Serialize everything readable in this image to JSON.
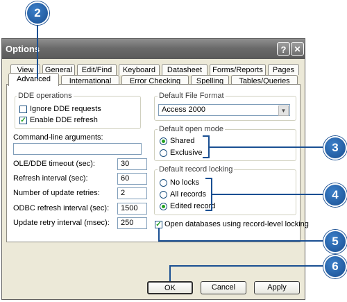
{
  "window": {
    "title": "Options",
    "help_glyph": "?",
    "close_glyph": "✕"
  },
  "tabs": {
    "row1": [
      "View",
      "General",
      "Edit/Find",
      "Keyboard",
      "Datasheet",
      "Forms/Reports",
      "Pages"
    ],
    "row2": [
      "Advanced",
      "International",
      "Error Checking",
      "Spelling",
      "Tables/Queries"
    ],
    "active": "Advanced"
  },
  "dde": {
    "group_label": "DDE operations",
    "ignore_label": "Ignore DDE requests",
    "ignore_checked": false,
    "enable_label": "Enable DDE refresh",
    "enable_checked": true
  },
  "cmdline": {
    "label": "Command-line arguments:",
    "value": ""
  },
  "settings": [
    {
      "label": "OLE/DDE timeout (sec):",
      "value": "30"
    },
    {
      "label": "Refresh interval (sec):",
      "value": "60"
    },
    {
      "label": "Number of update retries:",
      "value": "2"
    },
    {
      "label": "ODBC refresh interval (sec):",
      "value": "1500"
    },
    {
      "label": "Update retry interval (msec):",
      "value": "250"
    }
  ],
  "file_format": {
    "group_label": "Default File Format",
    "selected": "Access 2000"
  },
  "open_mode": {
    "group_label": "Default open mode",
    "options": [
      "Shared",
      "Exclusive"
    ],
    "selected": "Shared"
  },
  "record_locking": {
    "group_label": "Default record locking",
    "options": [
      "No locks",
      "All records",
      "Edited record"
    ],
    "selected": "Edited record"
  },
  "record_level": {
    "label": "Open databases using record-level locking",
    "checked": true
  },
  "buttons": {
    "ok": "OK",
    "cancel": "Cancel",
    "apply": "Apply"
  },
  "callouts": [
    "2",
    "3",
    "4",
    "5",
    "6"
  ],
  "colors": {
    "callout": "#1a4f92",
    "check": "#21a121",
    "title_bar": "#6b6b6b"
  }
}
